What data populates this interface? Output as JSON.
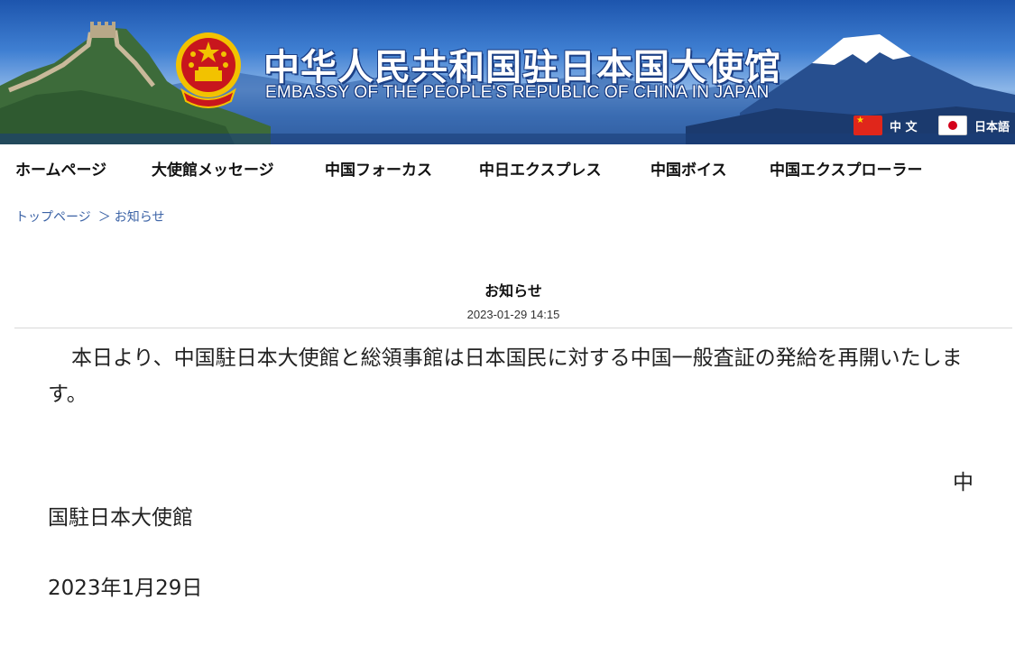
{
  "banner": {
    "title_cn": "中华人民共和国驻日本国大使馆",
    "title_en": "EMBASSY OF THE PEOPLE'S REPUBLIC OF CHINA IN JAPAN",
    "emblem_icon": "national-emblem-icon",
    "languages": [
      {
        "label": "中 文",
        "flag_icon": "china-flag-icon"
      },
      {
        "label": "日本語",
        "flag_icon": "japan-flag-icon"
      }
    ]
  },
  "nav": {
    "items": [
      {
        "label": "ホームページ"
      },
      {
        "label": "大使館メッセージ"
      },
      {
        "label": "中国フォーカス"
      },
      {
        "label": "中日エクスプレス"
      },
      {
        "label": "中国ボイス"
      },
      {
        "label": "中国エクスプローラー"
      }
    ]
  },
  "breadcrumb": {
    "home": "トップページ",
    "separator": "＞",
    "current": "お知らせ"
  },
  "article": {
    "title": "お知らせ",
    "date": "2023-01-29 14:15",
    "body": "本日より、中国駐日本大使館と総領事館は日本国民に対する中国一般査証の発給を再開いたします。",
    "signature_line1": "中",
    "signature_line2": "国駐日本大使館",
    "signature_date": "2023年1月29日"
  },
  "colors": {
    "banner_blue": "#1d55ad",
    "link_blue": "#3c63a6",
    "emblem_red": "#c8161d",
    "emblem_gold": "#f2c200"
  }
}
